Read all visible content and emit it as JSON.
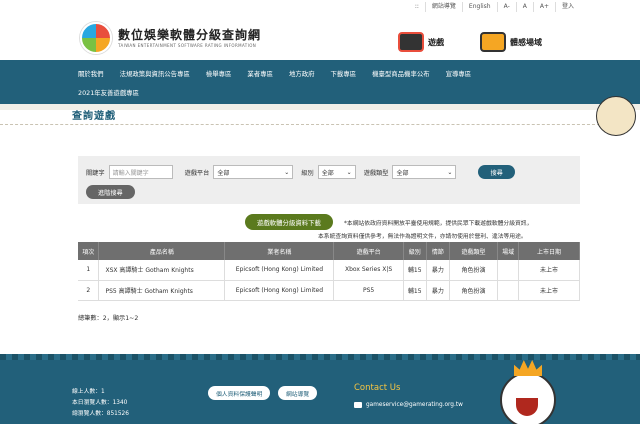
{
  "util_bar": {
    "items": [
      "::",
      "網站導覽",
      "English",
      "A-",
      "A",
      "A+",
      "登入"
    ]
  },
  "header": {
    "title": "數位娛樂軟體分級查詢網",
    "subtitle": "TAIWAN ENTERTAINMENT SOFTWARE RATING INFORMATION",
    "pic_game": "遊戲",
    "pic_body": "體感場域"
  },
  "nav": {
    "row1": [
      "關於我們",
      "法規政策與資訊公告專區",
      "檢舉專區",
      "業者專區",
      "地方政府",
      "下載專區",
      "機臺型商品機率公布",
      "宣導專區"
    ],
    "row2": [
      "2021年友善遊戲專區"
    ]
  },
  "page_title": "查詢遊戲",
  "search": {
    "keyword_label": "關鍵字",
    "keyword_placeholder": "請輸入關鍵字",
    "platform_label": "遊戲平台",
    "platform_value": "全部",
    "rating_label": "級別",
    "rating_value": "全部",
    "type_label": "遊戲類型",
    "type_value": "全部",
    "search_button": "搜尋",
    "advanced_button": "進階搜尋"
  },
  "download_button": "遊戲軟體分級資料下載",
  "notes": {
    "line1": "*本網站依政府資料開放平臺使用規範，提供民眾下載遊戲軟體分級資訊，",
    "line2": "本系統查詢資料僅供參考，無法作為證明文件，亦請勿使用於營利、違法等用途。"
  },
  "table": {
    "headers": [
      "項次",
      "產品名稱",
      "業者名稱",
      "遊戲平台",
      "級別",
      "情節",
      "遊戲類型",
      "場域",
      "上市日期"
    ],
    "rows": [
      [
        "1",
        "XSX 高譚騎士 Gotham Knights",
        "Epicsoft (Hong Kong) Limited",
        "Xbox Series X|S",
        "輔15",
        "暴力",
        "角色扮演",
        "",
        "未上市"
      ],
      [
        "2",
        "PS5 高譚騎士 Gotham Knights",
        "Epicsoft (Hong Kong) Limited",
        "PS5",
        "輔15",
        "暴力",
        "角色扮演",
        "",
        "未上市"
      ]
    ]
  },
  "result_count": "總筆數：2，顯示1~2",
  "footer": {
    "online_users": "線上人數：1",
    "today_visits": "本日瀏覽人數：1340",
    "total_visits": "總瀏覽人數：851526",
    "privacy_button": "個人資料保護聲明",
    "sitemap_button": "網站導覽",
    "contact_title": "Contact Us",
    "email": "gameservice@gamerating.org.tw"
  },
  "colors": {
    "primary": "#22607a",
    "download": "#5b7a1e",
    "table_header": "#6f6f6f",
    "search_bg": "#eeeeee"
  }
}
